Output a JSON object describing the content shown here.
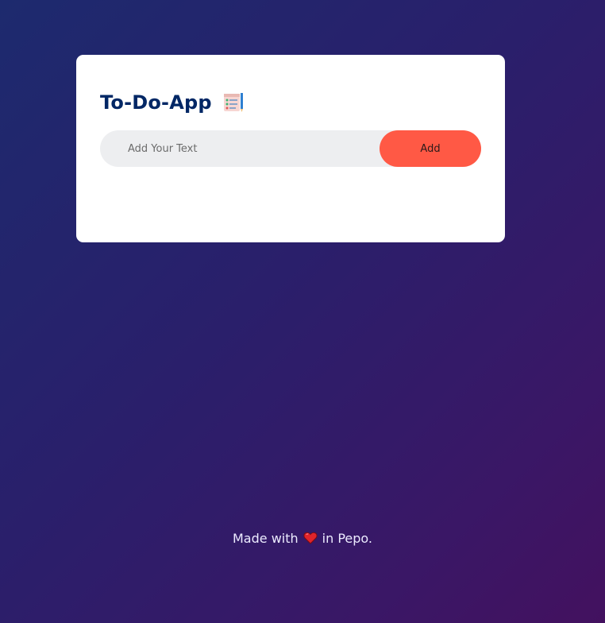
{
  "app": {
    "title": "To-Do-App",
    "title_icon": "notepad-checklist-icon"
  },
  "input": {
    "placeholder": "Add Your Text",
    "value": ""
  },
  "add_button": {
    "label": "Add"
  },
  "footer": {
    "prefix": "Made with",
    "icon": "heart-icon",
    "suffix": "in Pepo."
  },
  "colors": {
    "title": "#002765",
    "accent": "#ff5945",
    "input_bg": "#edeef0",
    "card_bg": "#ffffff",
    "bg_start": "#1d2a6e",
    "bg_end": "#43115f"
  }
}
